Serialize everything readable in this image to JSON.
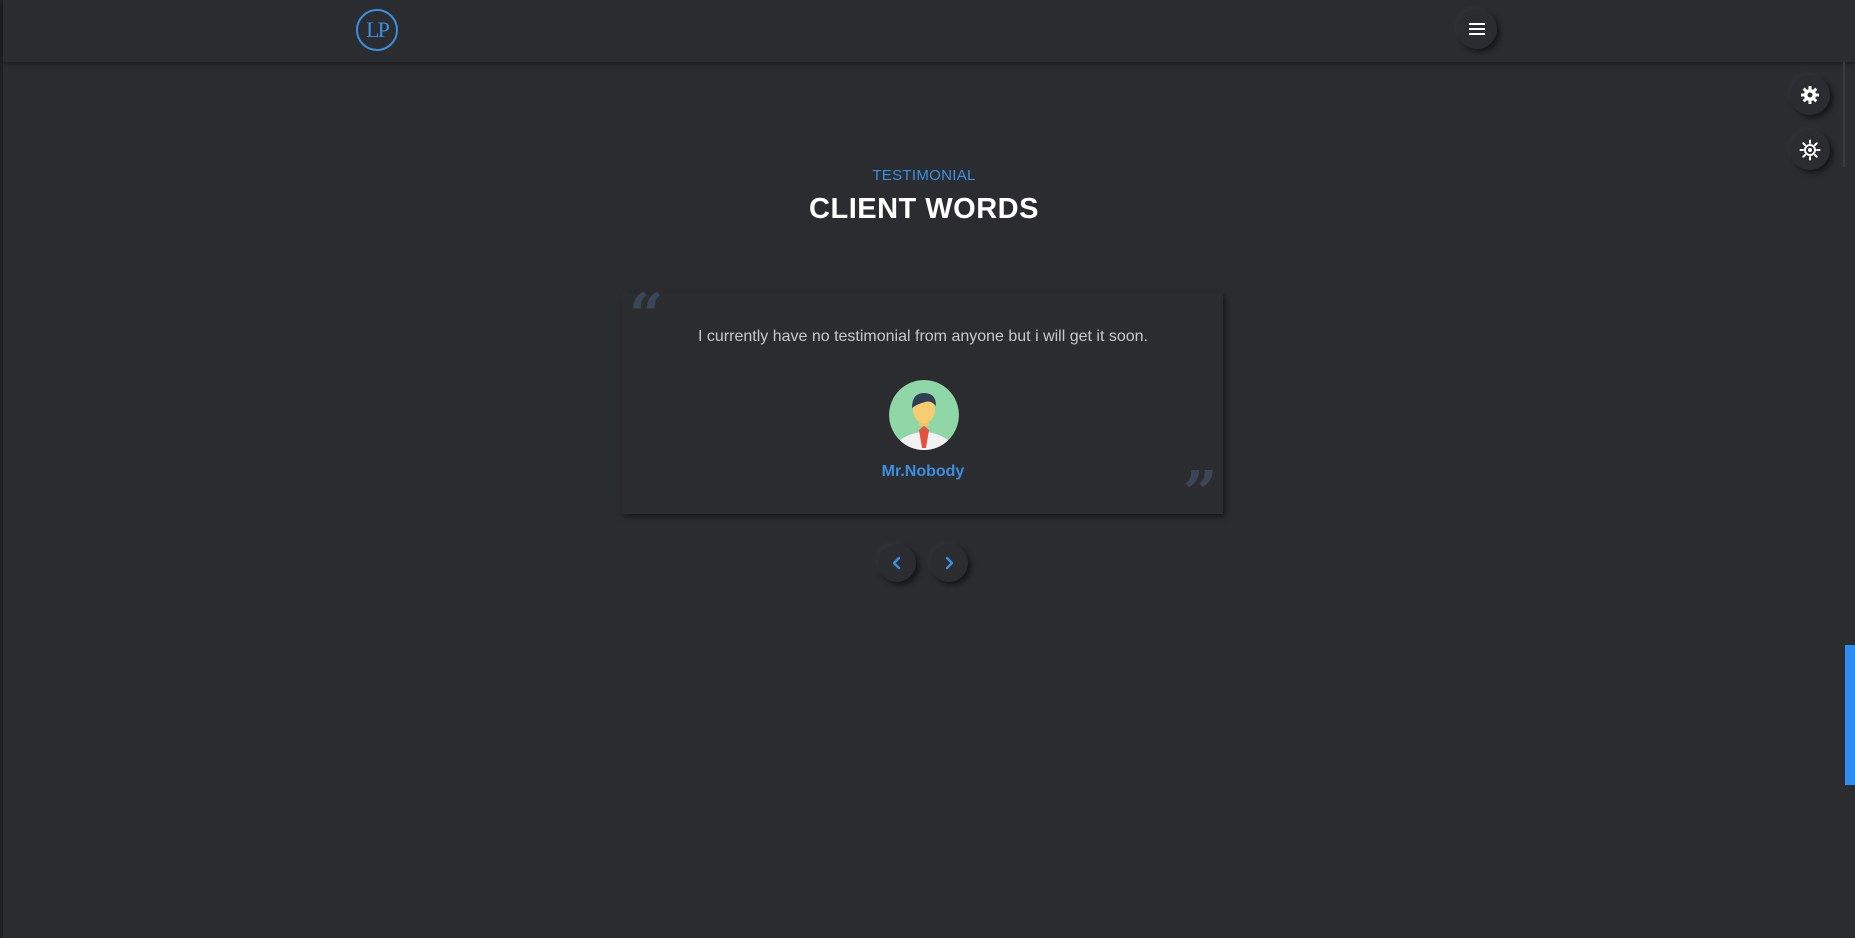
{
  "header": {
    "logo_text": "LP",
    "menu_icon": "hamburger-icon"
  },
  "floating_controls": {
    "settings_icon": "gear-icon",
    "theme_icon": "sun-icon"
  },
  "testimonial_section": {
    "eyebrow": "TESTIMONIAL",
    "title": "CLIENT WORDS",
    "quote_text": "I currently have no testimonial from anyone but i will get it soon.",
    "client_name": "Mr.Nobody",
    "prev_icon": "chevron-left-icon",
    "next_icon": "chevron-right-icon"
  },
  "colors": {
    "background": "#2b2c30",
    "accent": "#3a8fe0",
    "heading": "#ffffff",
    "body_text": "#c8c9cc",
    "quote_mark": "#3a4655"
  }
}
